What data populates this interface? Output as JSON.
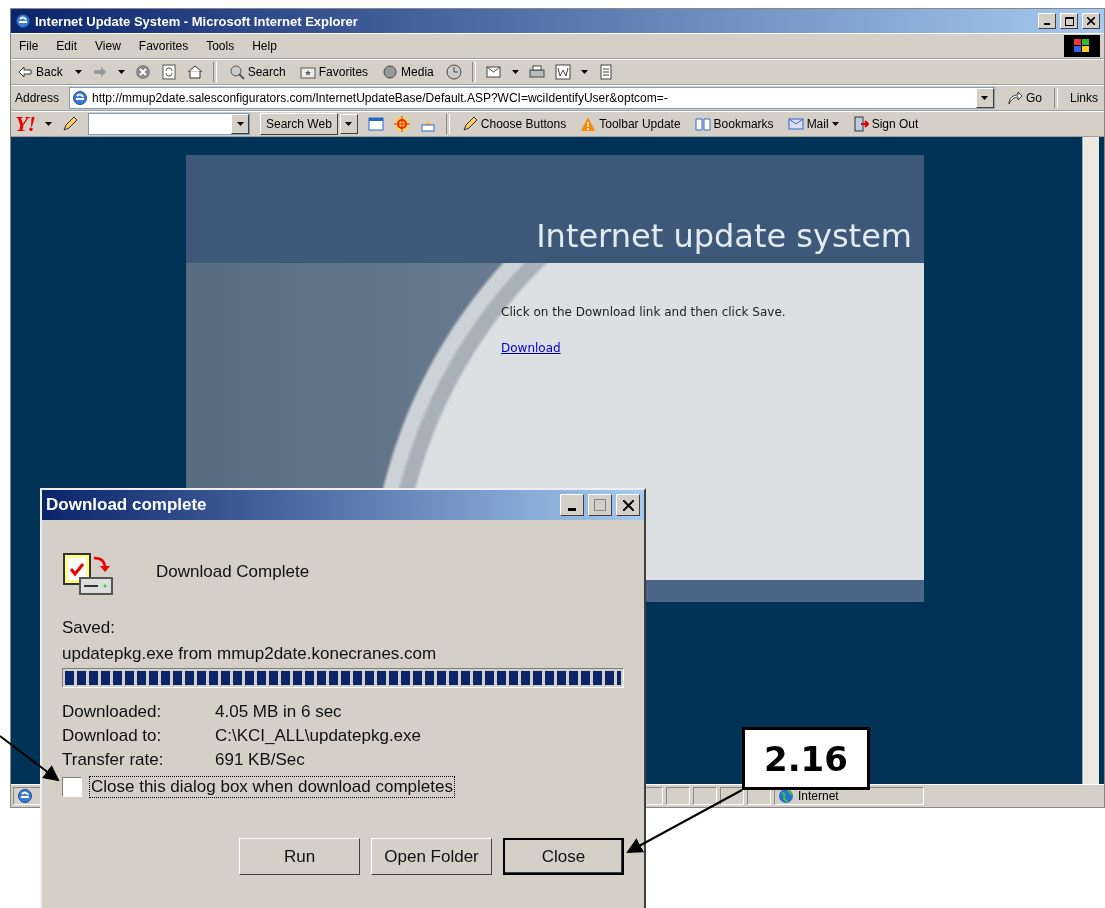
{
  "window": {
    "title": "Internet Update System - Microsoft Internet Explorer"
  },
  "menu": [
    "File",
    "Edit",
    "View",
    "Favorites",
    "Tools",
    "Help"
  ],
  "toolbar": {
    "back": "Back",
    "search": "Search",
    "favorites": "Favorites",
    "media": "Media"
  },
  "address": {
    "label": "Address",
    "value": "http://mmup2date.salesconfigurators.com/InternetUpdateBase/Default.ASP?WCI=wciIdentifyUser&optcom=-",
    "go": "Go",
    "links": "Links"
  },
  "yahoo_toolbar": {
    "logo": "Y!",
    "search_button": "Search Web",
    "items": [
      "Choose Buttons",
      "Toolbar Update",
      "Bookmarks",
      "Mail",
      "Sign Out"
    ]
  },
  "page": {
    "banner_title": "Internet update system",
    "instruction": "Click on the Download link and then click Save.",
    "link": "Download"
  },
  "status_bar": {
    "zone": "Internet"
  },
  "dialog": {
    "title": "Download complete",
    "heading": "Download Complete",
    "saved_label": "Saved:",
    "saved_file": "updatepkg.exe from mmup2date.konecranes.com",
    "progress": {
      "level": 1
    },
    "details": [
      {
        "label": "Downloaded:",
        "value": "4.05 MB in 6 sec"
      },
      {
        "label": "Download to:",
        "value": "C:\\KCI_ALL\\updatepkg.exe"
      },
      {
        "label": "Transfer rate:",
        "value": "691 KB/Sec"
      }
    ],
    "close_when_done": {
      "label": "Close this dialog box when download completes",
      "checked": false
    },
    "buttons": [
      {
        "label": "Run",
        "default": false
      },
      {
        "label": "Open Folder",
        "default": false
      },
      {
        "label": "Close",
        "default": true
      }
    ]
  },
  "annotation": {
    "label": "2.16"
  }
}
